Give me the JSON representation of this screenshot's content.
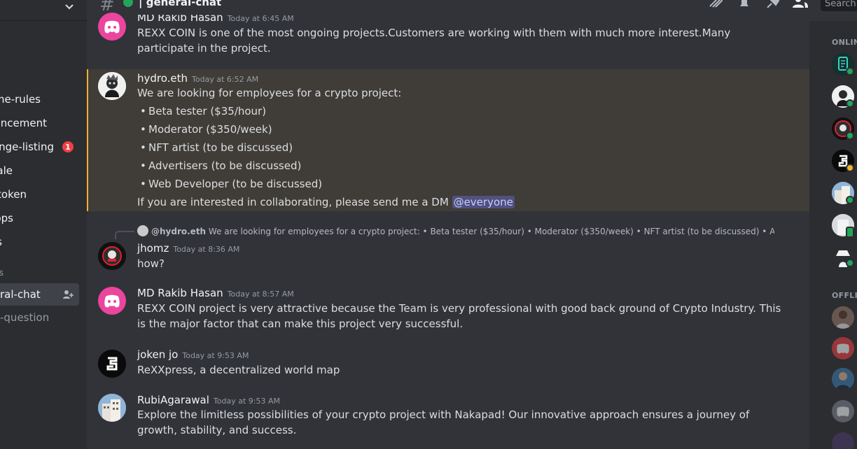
{
  "sidebar": {
    "channels": [
      {
        "label": "ome-rules"
      },
      {
        "label": "uncement"
      },
      {
        "label": "ange-listing",
        "badge": "1"
      },
      {
        "label": "ale"
      },
      {
        "label": "token"
      },
      {
        "label": "ops"
      },
      {
        "label": "s"
      },
      {
        "label": "s"
      },
      {
        "label": "ral-chat"
      },
      {
        "label": "-question"
      }
    ]
  },
  "header": {
    "channel_name": "| general-chat",
    "search_placeholder": "Search"
  },
  "messages": [
    {
      "author_partial": "MD Rakib Hasan",
      "time_partial": "Today at 6:45 AM",
      "text": "REXX COIN is one of the most ongoing projects.Customers are working with them with much more interest.Many participate in the project."
    },
    {
      "author": "hydro.eth",
      "time": "Today at 6:52 AM",
      "intro": "We are looking for employees for a crypto project:",
      "items": [
        "Beta tester ($35/hour)",
        "Moderator ($350/week)",
        "NFT artist (to be discussed)",
        "Advertisers (to be discussed)",
        "Web Developer (to be discussed)"
      ],
      "outro": "If you are interested in collaborating, please send me a DM",
      "mention": "@everyone"
    },
    {
      "reply_author": "@hydro.eth",
      "reply_text": "We are looking for employees for a crypto project: • Beta tester ($35/hour)  • Moderator ($350/week)  • NFT artist (to be discussed)  • Adv",
      "author": "jhomz",
      "time": "Today at 8:36 AM",
      "text": "how?"
    },
    {
      "author": "MD Rakib Hasan",
      "time": "Today at 8:57 AM",
      "text": "REXX COIN project is very attractive because the Team is very professional with good back ground of Crypto Industry. This is the major factor that can make this project very successful."
    },
    {
      "author": "joken  jo",
      "time": "Today at 9:53 AM",
      "text": "ReXXpress, a decentralized world map"
    },
    {
      "author": "RubiAgarawal",
      "time": "Today at 9:53 AM",
      "text": "Explore the limitless possibilities of your crypto project with Nakapad! Our innovative approach ensures a journey of growth, stability, and success."
    }
  ],
  "members": {
    "online_label": "ONLIN",
    "offline_label": "OFFLII"
  },
  "colors": {
    "accent": "#5865f2",
    "discord_pink": "#eb459e",
    "online": "#23a55a",
    "idle": "#f0b232",
    "highlight": "#f0b232"
  }
}
